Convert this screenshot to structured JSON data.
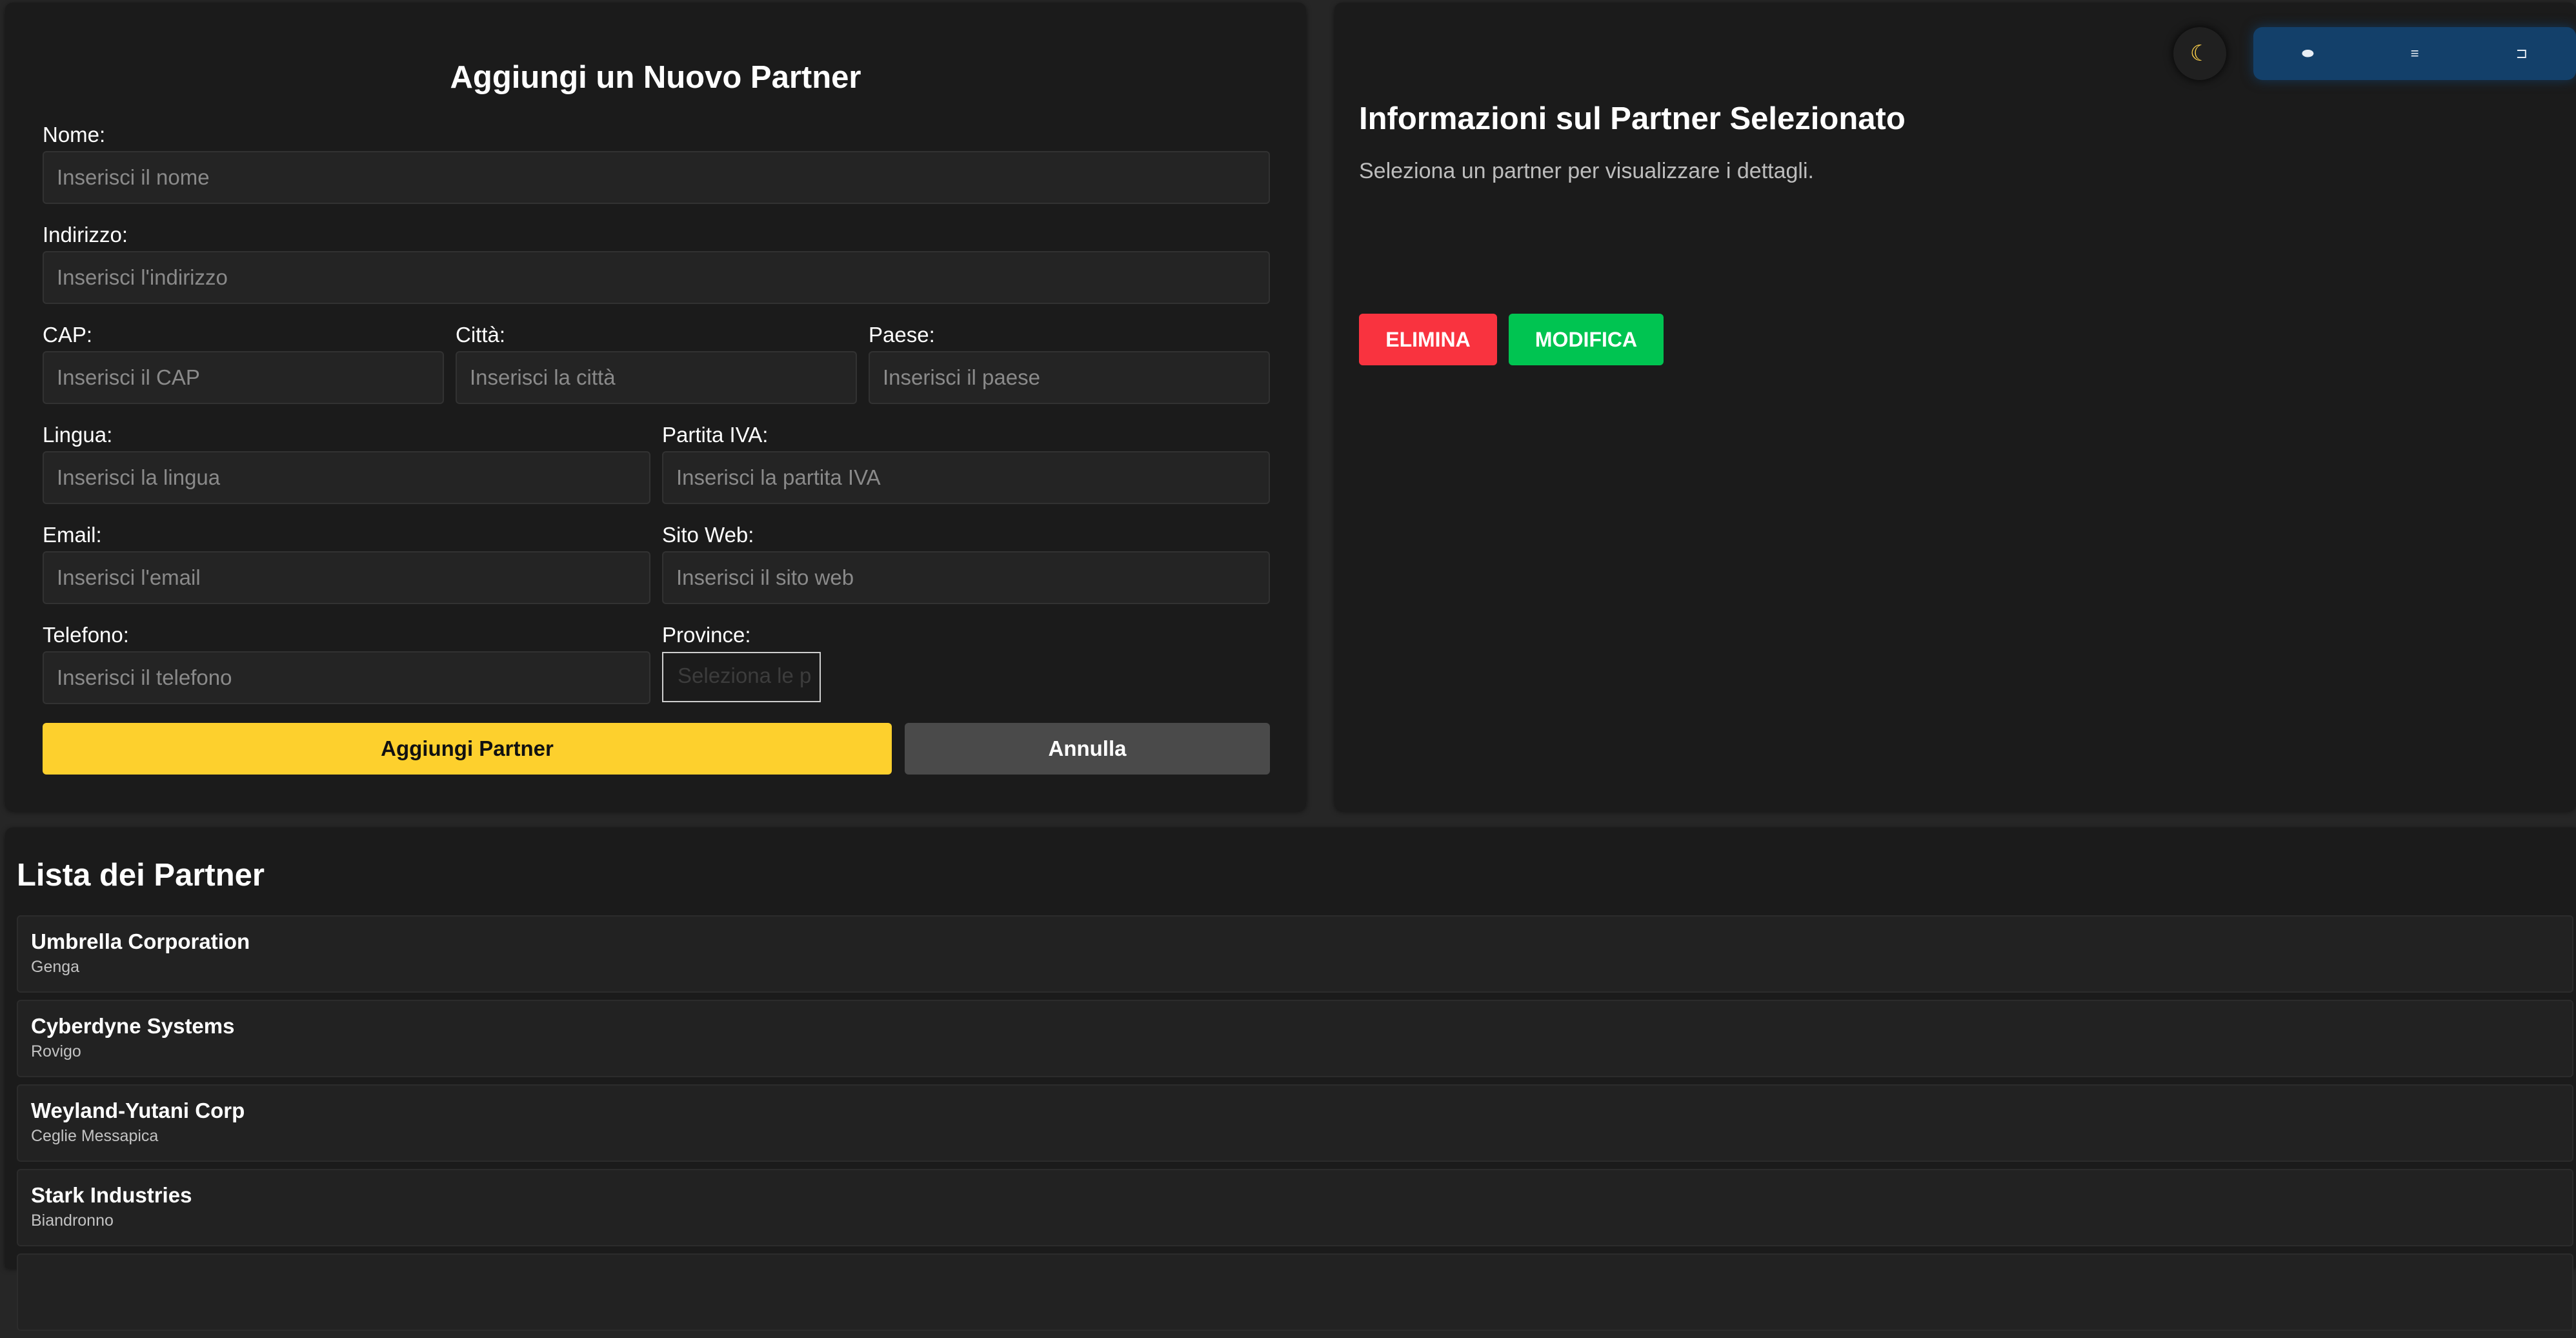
{
  "form": {
    "title": "Aggiungi un Nuovo Partner",
    "fields": {
      "name": {
        "label": "Nome:",
        "placeholder": "Inserisci il nome"
      },
      "address": {
        "label": "Indirizzo:",
        "placeholder": "Inserisci l'indirizzo"
      },
      "cap": {
        "label": "CAP:",
        "placeholder": "Inserisci il CAP"
      },
      "city": {
        "label": "Città:",
        "placeholder": "Inserisci la città"
      },
      "country": {
        "label": "Paese:",
        "placeholder": "Inserisci il paese"
      },
      "language": {
        "label": "Lingua:",
        "placeholder": "Inserisci la lingua"
      },
      "vat": {
        "label": "Partita IVA:",
        "placeholder": "Inserisci la partita IVA"
      },
      "email": {
        "label": "Email:",
        "placeholder": "Inserisci l'email"
      },
      "website": {
        "label": "Sito Web:",
        "placeholder": "Inserisci il sito web"
      },
      "phone": {
        "label": "Telefono:",
        "placeholder": "Inserisci il telefono"
      },
      "province": {
        "label": "Province:",
        "placeholder": "Seleziona le p"
      }
    },
    "submit_label": "Aggiungi Partner",
    "cancel_label": "Annulla"
  },
  "info": {
    "title": "Informazioni sul Partner Selezionato",
    "subtitle": "Seleziona un partner per visualizzare i dettagli.",
    "delete_label": "ELIMINA",
    "edit_label": "MODIFICA"
  },
  "toolbar": {
    "theme_icon": "☾",
    "view_icons": [
      "⬬",
      "≡",
      "⊐"
    ]
  },
  "list": {
    "title": "Lista dei Partner",
    "items": [
      {
        "name": "Umbrella Corporation",
        "city": "Genga"
      },
      {
        "name": "Cyberdyne Systems",
        "city": "Rovigo"
      },
      {
        "name": "Weyland-Yutani Corp",
        "city": "Ceglie Messapica"
      },
      {
        "name": "Stark Industries",
        "city": "Biandronno"
      }
    ]
  },
  "colors": {
    "accent_yellow": "#fdd02d",
    "danger": "#f9333f",
    "success": "#00c451",
    "panel_bg": "#1b1b1b"
  }
}
